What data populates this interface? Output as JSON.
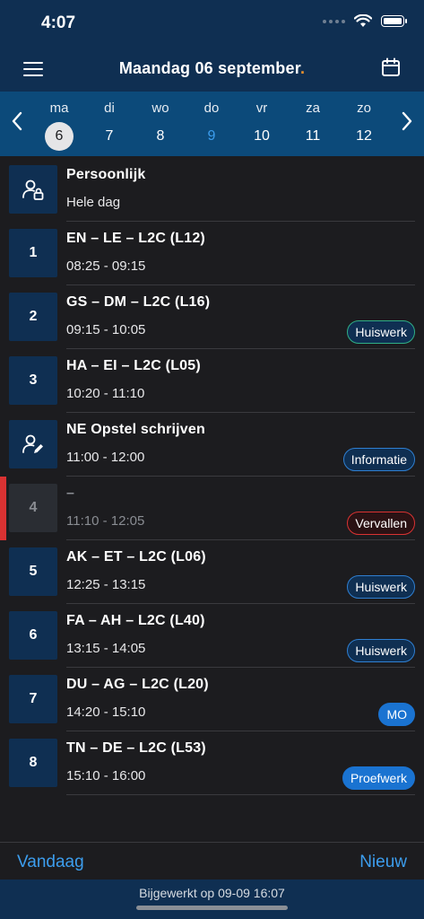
{
  "status": {
    "time": "4:07"
  },
  "header": {
    "title": "Maandag 06 september",
    "title_dot": ".",
    "accent": "#f0932b"
  },
  "week": {
    "days": [
      {
        "name": "ma",
        "num": "6",
        "selected": true
      },
      {
        "name": "di",
        "num": "7"
      },
      {
        "name": "wo",
        "num": "8"
      },
      {
        "name": "do",
        "num": "9",
        "today": true
      },
      {
        "name": "vr",
        "num": "10"
      },
      {
        "name": "za",
        "num": "11"
      },
      {
        "name": "zo",
        "num": "12"
      }
    ]
  },
  "lessons": [
    {
      "badge": "",
      "icon": "person-lock-icon",
      "title": "Persoonlijk",
      "time": "Hele dag",
      "tag": ""
    },
    {
      "badge": "1",
      "title": "EN – LE – L2C (L12)",
      "time": "08:25 - 09:15",
      "tag": ""
    },
    {
      "badge": "2",
      "title": "GS – DM – L2C (L16)",
      "time": "09:15 - 10:05",
      "tag": "Huiswerk",
      "tag_style": "green"
    },
    {
      "badge": "3",
      "title": "HA – EI – L2C (L05)",
      "time": "10:20 - 11:10",
      "tag": ""
    },
    {
      "badge": "",
      "icon": "person-edit-icon",
      "title": "NE Opstel schrijven",
      "time": "11:00 - 12:00",
      "tag": "Informatie",
      "tag_style": "blue"
    },
    {
      "badge": "4",
      "title": "–",
      "time": "11:10 - 12:05",
      "tag": "Vervallen",
      "tag_style": "red",
      "cancelled": true
    },
    {
      "badge": "5",
      "title": "AK – ET – L2C (L06)",
      "time": "12:25 - 13:15",
      "tag": "Huiswerk",
      "tag_style": "blue"
    },
    {
      "badge": "6",
      "title": "FA – AH – L2C (L40)",
      "time": "13:15 - 14:05",
      "tag": "Huiswerk",
      "tag_style": "blue"
    },
    {
      "badge": "7",
      "title": "DU – AG – L2C (L20)",
      "time": "14:20 - 15:10",
      "tag": "MO",
      "tag_style": "solid"
    },
    {
      "badge": "8",
      "title": "TN – DE – L2C (L53)",
      "time": "15:10 - 16:00",
      "tag": "Proefwerk",
      "tag_style": "solid"
    }
  ],
  "bottom": {
    "today_label": "Vandaag",
    "new_label": "Nieuw"
  },
  "footer": {
    "updated": "Bijgewerkt op 09-09 16:07"
  }
}
